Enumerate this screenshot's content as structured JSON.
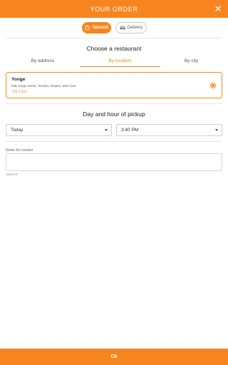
{
  "header": {
    "title": "YOUR ORDER",
    "close_icon": "close-icon"
  },
  "mode_toggle": {
    "takeout_label": "Takeout",
    "takeout_icon": "shopping-bag-icon",
    "delivery_label": "Delivery",
    "delivery_icon": "delivery-car-icon",
    "selected": "Takeout"
  },
  "restaurant_section": {
    "title": "Choose a restaurant",
    "tabs": [
      {
        "label": "By address"
      },
      {
        "label": "By location"
      },
      {
        "label": "By city"
      }
    ],
    "active_tab": "By location",
    "restaurants": [
      {
        "name": "Yonge",
        "address": "646 Yonge Street, Toronto, Ontario, M4Y 2A6",
        "distance": "715.1 Km",
        "selected": true
      }
    ]
  },
  "pickup_section": {
    "title": "Day and hour of pickup",
    "day_value": "Today",
    "time_value": "3:40 PM"
  },
  "notes": {
    "label": "Notes for counter",
    "value": "",
    "hint": "Optional"
  },
  "footer": {
    "ok_label": "Ok"
  },
  "colors": {
    "accent": "#f7851f",
    "border": "#cfcfcf",
    "divider": "#e6e6e6"
  }
}
